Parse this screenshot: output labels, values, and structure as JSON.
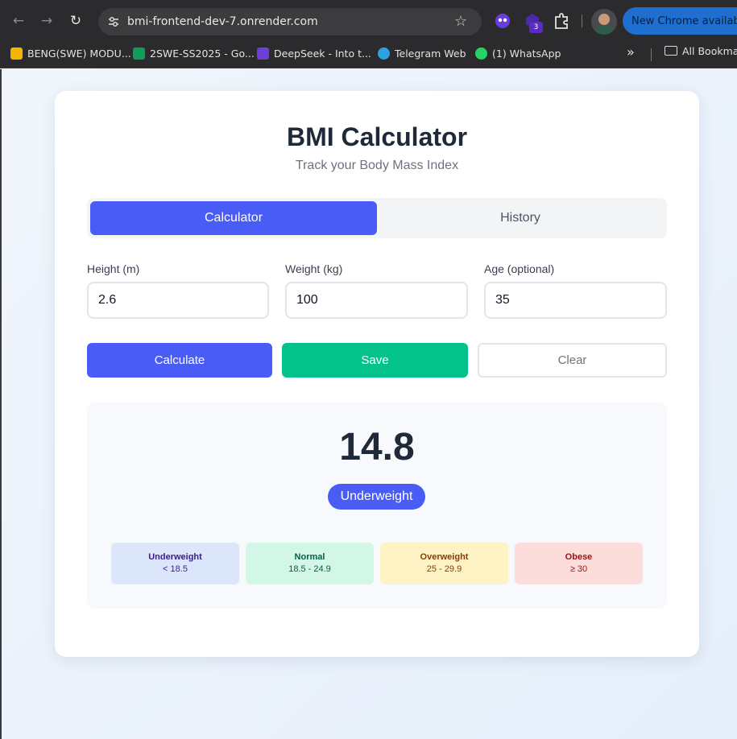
{
  "browser": {
    "url": "bmi-frontend-dev-7.onrender.com",
    "update_label": "New Chrome available",
    "extension_badge": "3",
    "bookmarks": [
      {
        "label": "BENG(SWE) MODU...",
        "icon": "google-drive-icon",
        "color": "#f4b400"
      },
      {
        "label": "2SWE-SS2025 - Go...",
        "icon": "google-sheets-icon",
        "color": "#0f9d58"
      },
      {
        "label": "DeepSeek - Into t...",
        "icon": "deepseek-icon",
        "color": "#6d3fd6"
      },
      {
        "label": "Telegram Web",
        "icon": "telegram-icon",
        "color": "#2aa3e2"
      },
      {
        "label": "(1) WhatsApp",
        "icon": "whatsapp-icon",
        "color": "#25d366"
      }
    ],
    "all_bookmarks_label": "All Bookmarks"
  },
  "app": {
    "title": "BMI Calculator",
    "subtitle": "Track your Body Mass Index",
    "tabs": [
      {
        "label": "Calculator",
        "active": true
      },
      {
        "label": "History",
        "active": false
      }
    ],
    "fields": [
      {
        "label": "Height (m)",
        "value": "2.6"
      },
      {
        "label": "Weight (kg)",
        "value": "100"
      },
      {
        "label": "Age (optional)",
        "value": "35"
      }
    ],
    "buttons": {
      "calculate": "Calculate",
      "save": "Save",
      "clear": "Clear"
    },
    "result": {
      "bmi": "14.8",
      "category": "Underweight"
    },
    "categories": [
      {
        "name": "Underweight",
        "range": "< 18.5",
        "bg": "#dbe6fb",
        "fg": "#3b1d8f"
      },
      {
        "name": "Normal",
        "range": "18.5 - 24.9",
        "bg": "#d3f7e6",
        "fg": "#06604a"
      },
      {
        "name": "Overweight",
        "range": "25 - 29.9",
        "bg": "#fdf3c4",
        "fg": "#8a3d07"
      },
      {
        "name": "Obese",
        "range": "≥ 30",
        "bg": "#fddcdc",
        "fg": "#9b1414"
      }
    ],
    "colors": {
      "accent": "#4a5cf6",
      "success": "#03c38a"
    }
  }
}
